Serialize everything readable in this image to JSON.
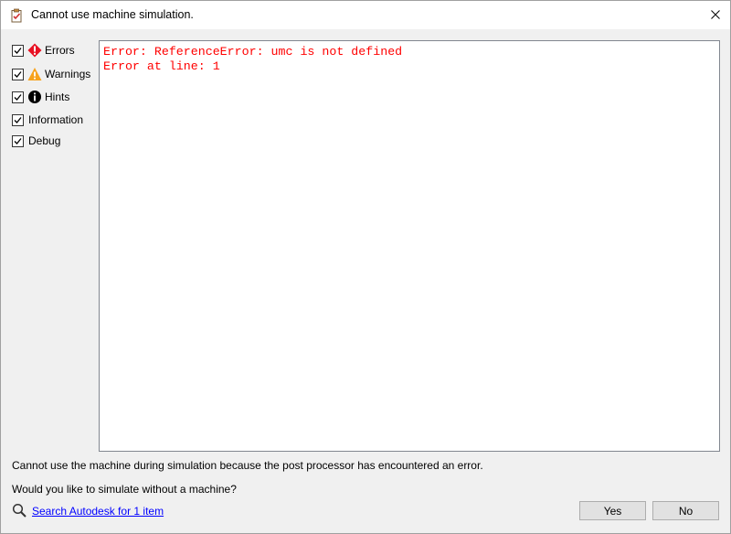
{
  "window": {
    "title": "Cannot use machine simulation.",
    "icon": "clipboard-check-icon"
  },
  "filters": [
    {
      "label": "Errors",
      "checked": true,
      "icon": "error-icon",
      "color": "#e81123"
    },
    {
      "label": "Warnings",
      "checked": true,
      "icon": "warning-icon",
      "color": "#f7a21b"
    },
    {
      "label": "Hints",
      "checked": true,
      "icon": "info-icon",
      "color": "#000000"
    },
    {
      "label": "Information",
      "checked": true,
      "icon": ""
    },
    {
      "label": "Debug",
      "checked": true,
      "icon": ""
    }
  ],
  "log": {
    "lines": [
      "Error: ReferenceError: umc is not defined",
      "Error at line: 1"
    ],
    "color": "#ff0000"
  },
  "message": "Cannot use the machine during simulation because the post processor has encountered an error.",
  "question": "Would you like to simulate without a machine?",
  "search": {
    "icon": "search-icon",
    "link_text": "Search Autodesk for 1 item"
  },
  "buttons": {
    "yes": "Yes",
    "no": "No"
  }
}
